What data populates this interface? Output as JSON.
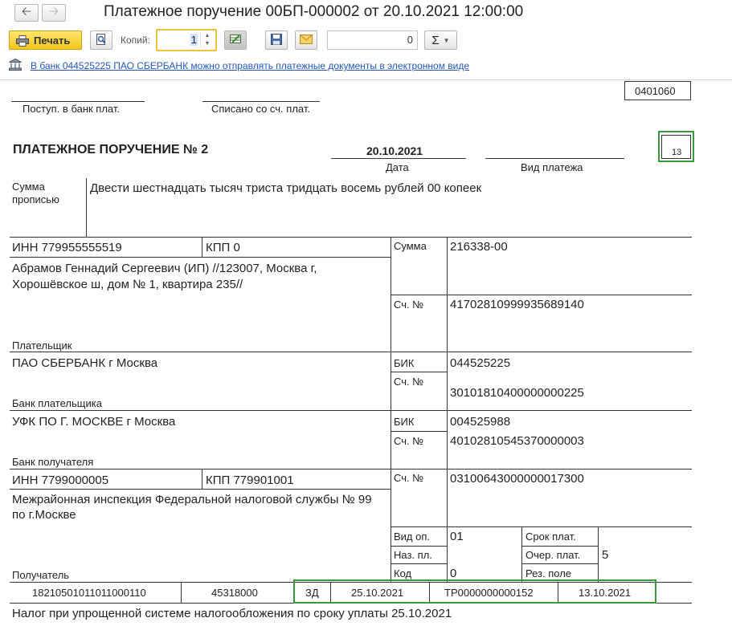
{
  "window": {
    "title": "Платежное поручение 00БП-000002 от 20.10.2021 12:00:00",
    "back_icon": "arrow-left",
    "forward_icon": "arrow-right"
  },
  "toolbar": {
    "print_label": "Печать",
    "copies_label": "Копий:",
    "copies_value": "1",
    "number_value": "0",
    "sum_symbol": "Σ"
  },
  "info": {
    "link_text": "В банк 044525225 ПАО СБЕРБАНК можно отправлять платежные документы в электронном виде"
  },
  "doc": {
    "form_code": "0401060",
    "received_label": "Поступ. в банк плат.",
    "debited_label": "Списано со сч. плат.",
    "title": "ПЛАТЕЖНОЕ ПОРУЧЕНИЕ № 2",
    "date": "20.10.2021",
    "date_label": "Дата",
    "payment_type_label": "Вид платежа",
    "status_code": "13",
    "sum_words_label_1": "Сумма",
    "sum_words_label_2": "прописью",
    "sum_words": "Двести шестнадцать тысяч триста тридцать восемь рублей 00 копеек",
    "payer_inn": "ИНН 779955555519",
    "payer_kpp": "КПП 0",
    "sum_label": "Сумма",
    "sum_value": "216338-00",
    "payer_name_1": "Абрамов Геннадий Сергеевич (ИП) //123007, Москва г,",
    "payer_name_2": "Хорошёвское ш, дом № 1, квартира 235//",
    "account_label": "Сч. №",
    "payer_account": "41702810999935689140",
    "payer_label": "Плательщик",
    "payer_bank": "ПАО СБЕРБАНК г Москва",
    "bik_label": "БИК",
    "payer_bik": "044525225",
    "payer_bank_account": "30101810400000000225",
    "payer_bank_label": "Банк плательщика",
    "recipient_bank": "УФК ПО Г. МОСКВЕ г Москва",
    "recipient_bik": "004525988",
    "recipient_bank_account": "40102810545370000003",
    "recipient_bank_label": "Банк получателя",
    "recipient_inn": "ИНН 7799000005",
    "recipient_kpp": "КПП 779901001",
    "recipient_account": "03100643000000017300",
    "recipient_name_1": "Межрайонная инспекция Федеральной налоговой службы № 99",
    "recipient_name_2": "по г.Москве",
    "op_type_label": "Вид оп.",
    "op_type_value": "01",
    "due_label": "Срок плат.",
    "purpose_code_label": "Наз. пл.",
    "priority_label": "Очер. плат.",
    "priority_value": "5",
    "code_label": "Код",
    "code_value": "0",
    "reserve_label": "Рез. поле",
    "recipient_label": "Получатель",
    "kbk": "18210501011011000110",
    "oktmo": "45318000",
    "basis": "ЗД",
    "tax_period": "25.10.2021",
    "doc_number": "ТР0000000000152",
    "doc_date": "13.10.2021",
    "purpose": "Налог при упрощенной системе налогообложения по сроку уплаты 25.10.2021"
  }
}
